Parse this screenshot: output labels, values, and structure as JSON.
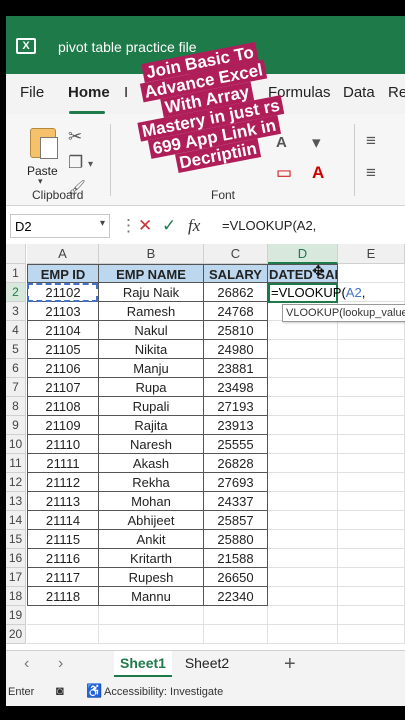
{
  "window": {
    "title": "pivot table practice file",
    "app_icon": "excel-logo-icon"
  },
  "ribbon_tabs": [
    {
      "label": "File"
    },
    {
      "label": "Home"
    },
    {
      "label": "I"
    },
    {
      "label": "Formulas"
    },
    {
      "label": "Data"
    },
    {
      "label": "Re"
    }
  ],
  "ribbon": {
    "paste_label": "Paste",
    "clipboard_label": "Clipboard",
    "font_label": "Font"
  },
  "promo": {
    "lines": [
      "Join Basic To",
      "Advance Excel",
      "With Array",
      "Mastery in just rs",
      "699 App Link in",
      "Decriptiin"
    ]
  },
  "formula_bar": {
    "name_box": "D2",
    "cancel": "✕",
    "enter": "✓",
    "fx": "fx",
    "formula": "=VLOOKUP(A2,"
  },
  "grid": {
    "columns": [
      "A",
      "B",
      "C",
      "D",
      "E"
    ],
    "headers": [
      "EMP ID",
      "EMP NAME",
      "SALARY",
      "DATED SALARY"
    ],
    "rows": [
      [
        "21102",
        "Raju Naik",
        "26862"
      ],
      [
        "21103",
        "Ramesh",
        "24768"
      ],
      [
        "21104",
        "Nakul",
        "25810"
      ],
      [
        "21105",
        "Nikita",
        "24980"
      ],
      [
        "21106",
        "Manju",
        "23881"
      ],
      [
        "21107",
        "Rupa",
        "23498"
      ],
      [
        "21108",
        "Rupali",
        "27193"
      ],
      [
        "21109",
        "Rajita",
        "23913"
      ],
      [
        "21110",
        "Naresh",
        "25555"
      ],
      [
        "21111",
        "Akash",
        "26828"
      ],
      [
        "21112",
        "Rekha",
        "27693"
      ],
      [
        "21113",
        "Mohan",
        "24337"
      ],
      [
        "21114",
        "Abhijeet",
        "25857"
      ],
      [
        "21115",
        "Ankit",
        "25880"
      ],
      [
        "21116",
        "Kritarth",
        "21588"
      ],
      [
        "21117",
        "Rupesh",
        "26650"
      ],
      [
        "21118",
        "Mannu",
        "22340"
      ]
    ],
    "row_numbers": [
      "1",
      "2",
      "3",
      "4",
      "5",
      "6",
      "7",
      "8",
      "9",
      "10",
      "11",
      "12",
      "13",
      "14",
      "15",
      "16",
      "17",
      "18",
      "19",
      "20"
    ],
    "editing_prefix": "=VLOOKUP(",
    "editing_ref": "A2",
    "editing_suffix": ",",
    "tooltip": "VLOOKUP(lookup_value, table_array, col_index_num, [range_lookup])"
  },
  "sheet_tabs": [
    {
      "label": "Sheet1",
      "active": true
    },
    {
      "label": "Sheet2",
      "active": false
    }
  ],
  "status_bar": {
    "mode": "Enter",
    "accessibility": "Accessibility: Investigate"
  },
  "colors": {
    "excel_green": "#1f7a4a",
    "header_fill": "#bdd7ee",
    "promo_bg": "#b01e5a",
    "ref_blue": "#4472c4"
  }
}
